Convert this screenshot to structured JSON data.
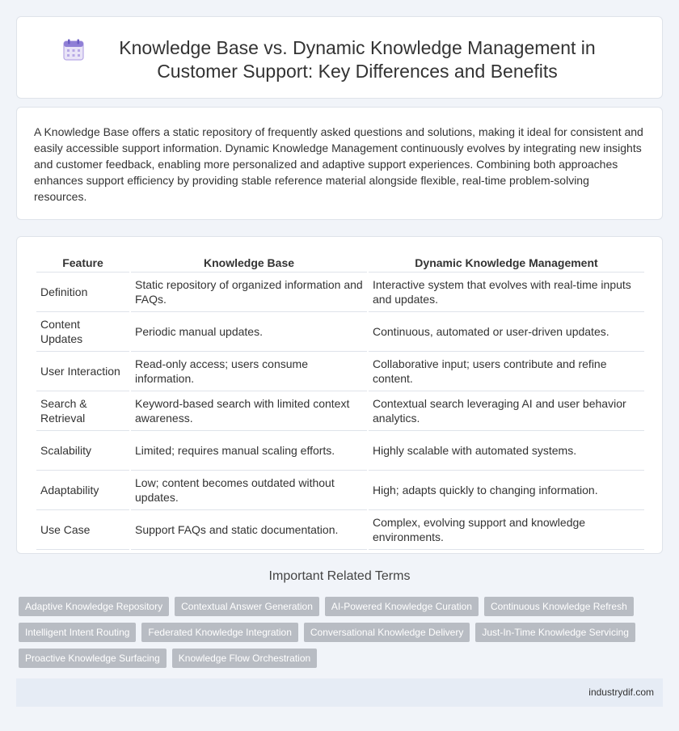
{
  "header": {
    "icon": "calendar-icon",
    "title": "Knowledge Base vs. Dynamic Knowledge Management in Customer Support: Key Differences and Benefits"
  },
  "intro": {
    "text": "A Knowledge Base offers a static repository of frequently asked questions and solutions, making it ideal for consistent and easily accessible support information. Dynamic Knowledge Management continuously evolves by integrating new insights and customer feedback, enabling more personalized and adaptive support experiences. Combining both approaches enhances support efficiency by providing stable reference material alongside flexible, real-time problem-solving resources."
  },
  "table": {
    "headers": [
      "Feature",
      "Knowledge Base",
      "Dynamic Knowledge Management"
    ],
    "rows": [
      [
        "Definition",
        "Static repository of organized information and FAQs.",
        "Interactive system that evolves with real-time inputs and updates."
      ],
      [
        "Content Updates",
        "Periodic manual updates.",
        "Continuous, automated or user-driven updates."
      ],
      [
        "User Interaction",
        "Read-only access; users consume information.",
        "Collaborative input; users contribute and refine content."
      ],
      [
        "Search & Retrieval",
        "Keyword-based search with limited context awareness.",
        "Contextual search leveraging AI and user behavior analytics."
      ],
      [
        "Scalability",
        "Limited; requires manual scaling efforts.",
        "Highly scalable with automated systems."
      ],
      [
        "Adaptability",
        "Low; content becomes outdated without updates.",
        "High; adapts quickly to changing information."
      ],
      [
        "Use Case",
        "Support FAQs and static documentation.",
        "Complex, evolving support and knowledge environments."
      ]
    ]
  },
  "related": {
    "title": "Important Related Terms",
    "tags": [
      "Adaptive Knowledge Repository",
      "Contextual Answer Generation",
      "AI-Powered Knowledge Curation",
      "Continuous Knowledge Refresh",
      "Intelligent Intent Routing",
      "Federated Knowledge Integration",
      "Conversational Knowledge Delivery",
      "Just-In-Time Knowledge Servicing",
      "Proactive Knowledge Surfacing",
      "Knowledge Flow Orchestration"
    ]
  },
  "footer": {
    "site": "industrydif.com"
  }
}
